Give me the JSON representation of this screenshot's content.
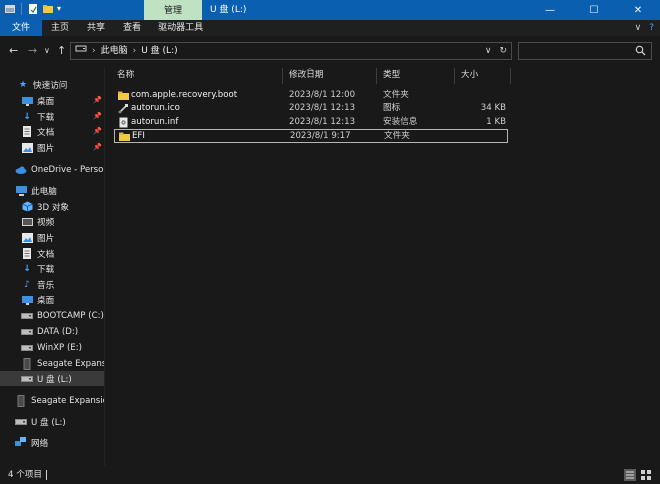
{
  "titlebar": {
    "context_tab": "管理",
    "title": "U 盘 (L:)",
    "minimize": "—",
    "maximize": "☐",
    "close": "✕"
  },
  "ribbon": {
    "tabs": [
      "文件",
      "主页",
      "共享",
      "查看",
      "驱动器工具"
    ],
    "expand": "∨",
    "help": "?"
  },
  "address": {
    "crumbs": [
      "此电脑",
      "U 盘 (L:)"
    ],
    "dropdown": "∨",
    "refresh": "↻"
  },
  "search": {
    "placeholder": ""
  },
  "sidebar": {
    "items": [
      {
        "label": "快速访问",
        "icon": "star-icon"
      },
      {
        "label": "桌面",
        "icon": "desktop-icon"
      },
      {
        "label": "下载",
        "icon": "download-icon"
      },
      {
        "label": "文档",
        "icon": "document-icon"
      },
      {
        "label": "图片",
        "icon": "picture-icon"
      },
      {
        "label": "OneDrive - Persona",
        "icon": "cloud-icon"
      },
      {
        "label": "此电脑",
        "icon": "computer-icon"
      },
      {
        "label": "3D 对象",
        "icon": "cube-icon"
      },
      {
        "label": "视频",
        "icon": "video-icon"
      },
      {
        "label": "图片",
        "icon": "picture-icon"
      },
      {
        "label": "文档",
        "icon": "document-icon"
      },
      {
        "label": "下载",
        "icon": "download-icon"
      },
      {
        "label": "音乐",
        "icon": "music-icon"
      },
      {
        "label": "桌面",
        "icon": "desktop-icon"
      },
      {
        "label": "BOOTCAMP (C:)",
        "icon": "drive-icon"
      },
      {
        "label": "DATA (D:)",
        "icon": "drive-icon"
      },
      {
        "label": "WinXP  (E:)",
        "icon": "drive-icon"
      },
      {
        "label": "Seagate Expansion",
        "icon": "external-drive-icon"
      },
      {
        "label": "U 盘 (L:)",
        "icon": "usb-drive-icon"
      },
      {
        "label": "Seagate Expansion",
        "icon": "external-drive-icon"
      },
      {
        "label": "U 盘 (L:)",
        "icon": "usb-drive-icon"
      },
      {
        "label": "网络",
        "icon": "network-icon"
      }
    ]
  },
  "columns": {
    "name": "名称",
    "date": "修改日期",
    "type": "类型",
    "size": "大小"
  },
  "files": [
    {
      "name": "com.apple.recovery.boot",
      "date": "2023/8/1 12:00",
      "type": "文件夹",
      "size": "",
      "icon": "folder-icon"
    },
    {
      "name": "autorun.ico",
      "date": "2023/8/1 12:13",
      "type": "图标",
      "size": "34 KB",
      "icon": "ico-file-icon"
    },
    {
      "name": "autorun.inf",
      "date": "2023/8/1 12:13",
      "type": "安装信息",
      "size": "1 KB",
      "icon": "inf-file-icon"
    },
    {
      "name": "EFI",
      "date": "2023/8/1 9:17",
      "type": "文件夹",
      "size": "",
      "icon": "folder-icon"
    }
  ],
  "status": {
    "count": "4 个项目"
  },
  "colors": {
    "titlebar": "#0a5fb0",
    "context_tab": "#bfe3c2",
    "background": "#191919",
    "folder": "#f0c94b"
  }
}
